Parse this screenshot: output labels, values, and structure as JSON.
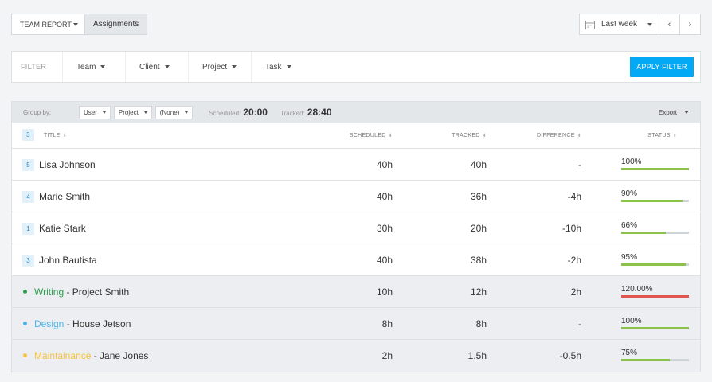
{
  "toolbar": {
    "report_label": "TEAM REPORT",
    "assignments_label": "Assignments",
    "date_label": "Last week"
  },
  "filter": {
    "label": "FILTER",
    "items": [
      "Team",
      "Client",
      "Project",
      "Task"
    ],
    "apply_label": "APPLY FILTER"
  },
  "groupbar": {
    "label": "Group by:",
    "selects": [
      "User",
      "Project",
      "(None)"
    ],
    "scheduled_label": "Scheduled:",
    "scheduled_value": "20:00",
    "tracked_label": "Tracked:",
    "tracked_value": "28:40",
    "export_label": "Export"
  },
  "table": {
    "count": "3",
    "headers": {
      "title": "TITLE",
      "scheduled": "SCHEDULED",
      "tracked": "TRACKED",
      "difference": "DIFFERENCE",
      "status": "STATUS"
    },
    "rows": [
      {
        "badge": "5",
        "name": "Lisa Johnson",
        "scheduled": "40h",
        "tracked": "40h",
        "difference": "-",
        "status": "100%",
        "progress": 1.0,
        "color": "#8bc34a"
      },
      {
        "badge": "4",
        "name": "Marie Smith",
        "scheduled": "40h",
        "tracked": "36h",
        "difference": "-4h",
        "status": "90%",
        "progress": 0.9,
        "color": "#8bc34a"
      },
      {
        "badge": "1",
        "name": "Katie Stark",
        "scheduled": "30h",
        "tracked": "20h",
        "difference": "-10h",
        "status": "66%",
        "progress": 0.66,
        "color": "#8bc34a"
      },
      {
        "badge": "3",
        "name": "John Bautista",
        "scheduled": "40h",
        "tracked": "38h",
        "difference": "-2h",
        "status": "95%",
        "progress": 0.95,
        "color": "#8bc34a"
      }
    ],
    "grouped": [
      {
        "tag": "Writing",
        "tag_color": "#2e9e4e",
        "rest": " - Project Smith",
        "scheduled": "10h",
        "tracked": "12h",
        "difference": "2h",
        "status": "120.00%",
        "progress": 1.0,
        "color": "#e0574f"
      },
      {
        "tag": "Design",
        "tag_color": "#4fb6e8",
        "rest": " - House Jetson",
        "scheduled": "8h",
        "tracked": "8h",
        "difference": "-",
        "status": "100%",
        "progress": 1.0,
        "color": "#8bc34a"
      },
      {
        "tag": "Maintainance",
        "tag_color": "#f5c342",
        "rest": " - Jane Jones",
        "scheduled": "2h",
        "tracked": "1.5h",
        "difference": "-0.5h",
        "status": "75%",
        "progress": 0.72,
        "color": "#8bc34a"
      }
    ]
  }
}
